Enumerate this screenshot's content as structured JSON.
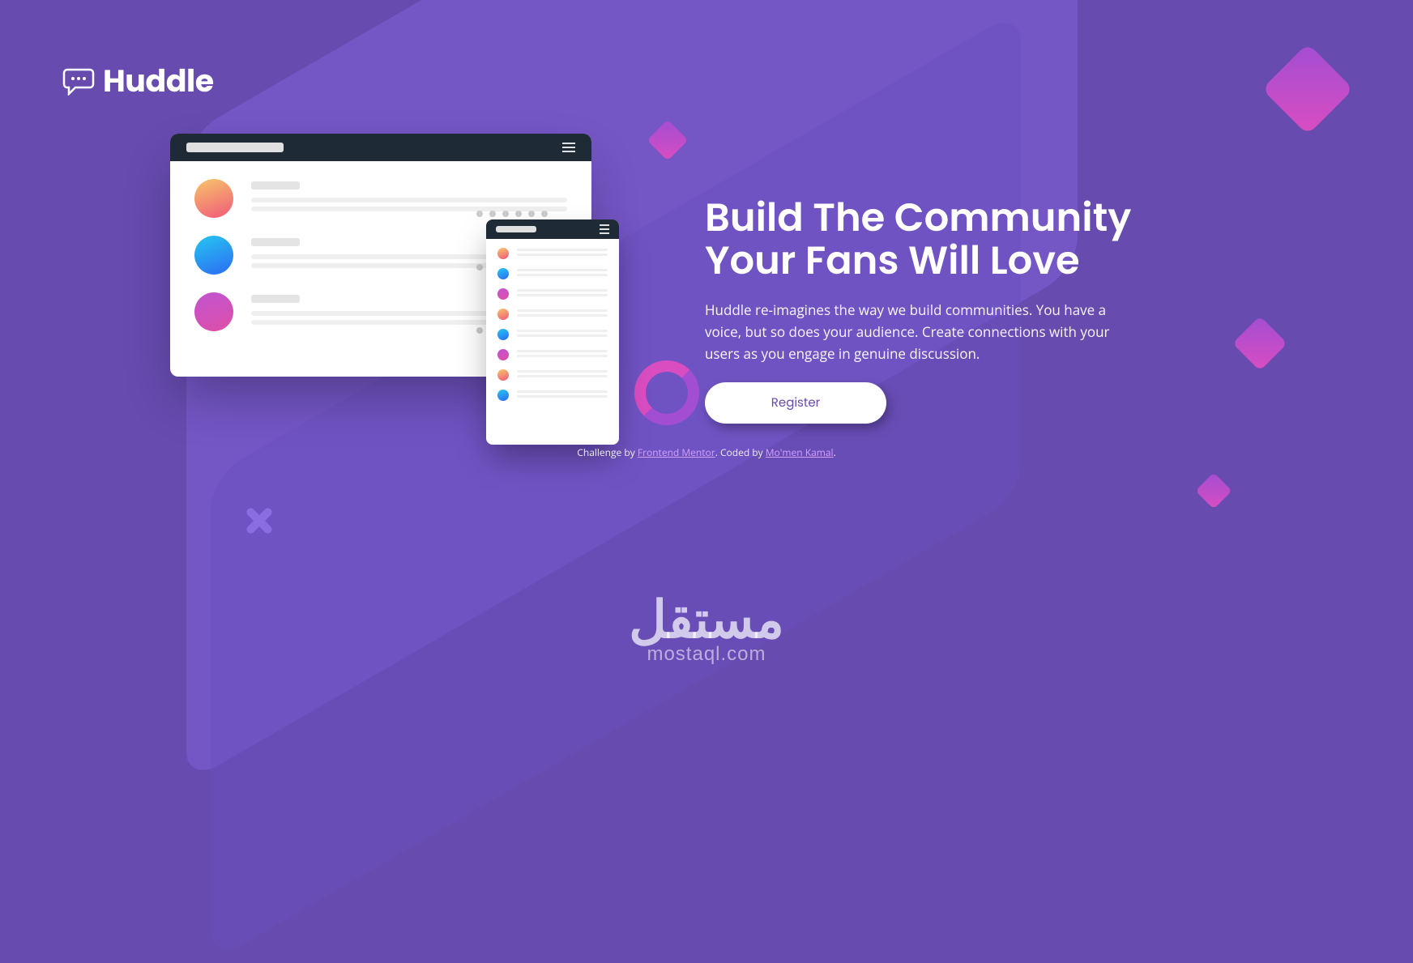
{
  "brand": {
    "name": "Huddle"
  },
  "hero": {
    "headline_line1": "Build The Community",
    "headline_line2": "Your Fans Will Love",
    "subtitle": "Huddle re-imagines the way we build communities. You have a voice, but so does your audience. Create connections with your users as you engage in genuine discussion.",
    "register_label": "Register"
  },
  "attribution": {
    "prefix": "Challenge by",
    "link1": "Frontend Mentor",
    "separator": ". Coded by",
    "link2": "Mo'men Kamal",
    "suffix": "."
  },
  "watermark": {
    "arabic": "مستقل",
    "latin": "mostaql.com"
  }
}
